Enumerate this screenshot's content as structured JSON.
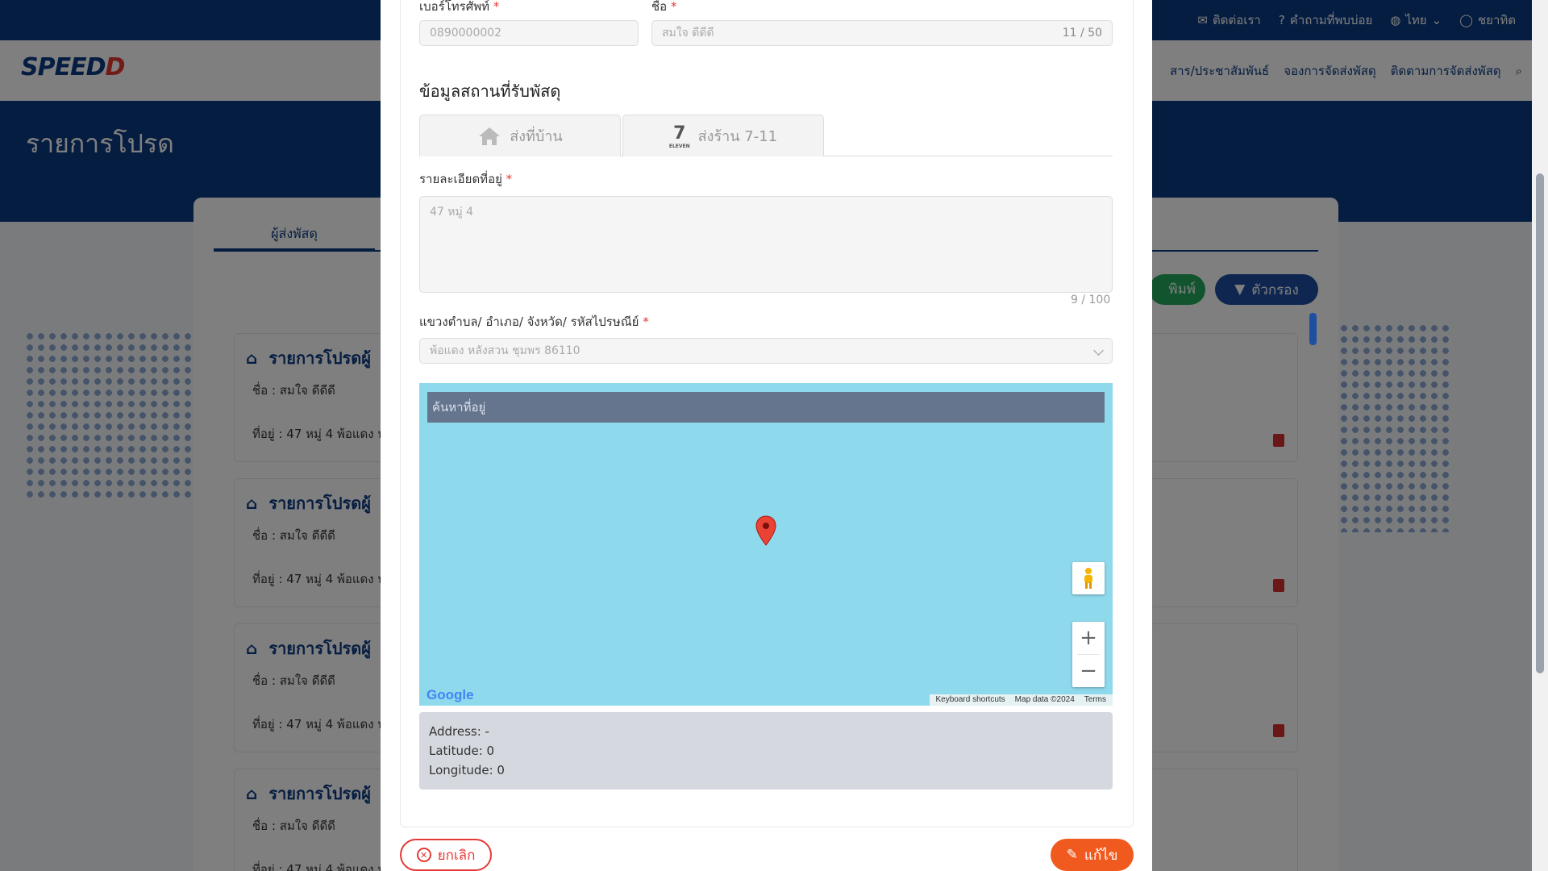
{
  "header": {
    "contact_label": "ติดต่อเรา",
    "faq_label": "คำถามที่พบบ่อย",
    "language_label": "ไทย",
    "user_label": "ชยาทิต"
  },
  "navbar": {
    "logo_text": "SPEED",
    "logo_mark": "D",
    "menu": [
      "สาร/ประชาสัมพันธ์",
      "จองการจัดส่งพัสดุ",
      "ติดตามการจัดส่งพัสดุ"
    ]
  },
  "page": {
    "title": "รายการโปรด",
    "tab_label": "ผู้ส่งพัสดุ",
    "print_label": "พิมพ์",
    "filter_label": "ตัวกรอง"
  },
  "favorites": [
    {
      "title": "รายการโปรดผู้",
      "name": "ชื่อ : สมใจ ดีดีดี",
      "address": "ที่อยู่ : 47 หมู่ 4 พ้อแดง ห"
    },
    {
      "title": "รายการโปรดผู้",
      "name": "ชื่อ : สมใจ ดีดีดี",
      "address": "ที่อยู่ : 47 หมู่ 4 พ้อแดง ห"
    },
    {
      "title": "รายการโปรดผู้",
      "name": "ชื่อ : สมใจ ดีดีดี",
      "address": "ที่อยู่ : 47 หมู่ 4 พ้อแดง ห"
    },
    {
      "title": "รายการโปรดผู้",
      "name": "ชื่อ : สมใจ ดีดีดี",
      "address": "ที่อยู่ : 47 หมู่ 4 พ้อแดง ห"
    }
  ],
  "modal": {
    "phone_label": "เบอร์โทรศัพท์",
    "phone_value": "0890000002",
    "name_label": "ชื่อ",
    "name_value": "สมใจ ดีดีดี",
    "name_counter": "11 / 50",
    "section_title": "ข้อมูลสถานที่รับพัสดุ",
    "tab_home": "ส่งที่บ้าน",
    "tab_store": "ส่งร้าน 7-11",
    "store_icon_text": "ELEVEN",
    "address_label": "รายละเอียดที่อยู่",
    "address_value": "47 หมู่ 4",
    "address_counter": "9 / 100",
    "district_label": "แขวงตำบล/ อำเภอ/ จังหวัด/ รหัสไปรษณีย์",
    "district_value": "พ้อแดง หลังสวน ชุมพร 86110",
    "map_search_placeholder": "ค้นหาที่อยู่",
    "google_logo": "Google",
    "map_attrib": [
      "Keyboard shortcuts",
      "Map data ©2024",
      "Terms"
    ],
    "info_address": "Address: -",
    "info_lat": "Latitude: 0",
    "info_lng": "Longitude: 0",
    "cancel_label": "ยกเลิก",
    "edit_label": "แก้ไข"
  },
  "colors": {
    "primary": "#0a3a82",
    "accent": "#f05a1e",
    "danger": "#e53935",
    "map_water": "#8fd9ec"
  }
}
